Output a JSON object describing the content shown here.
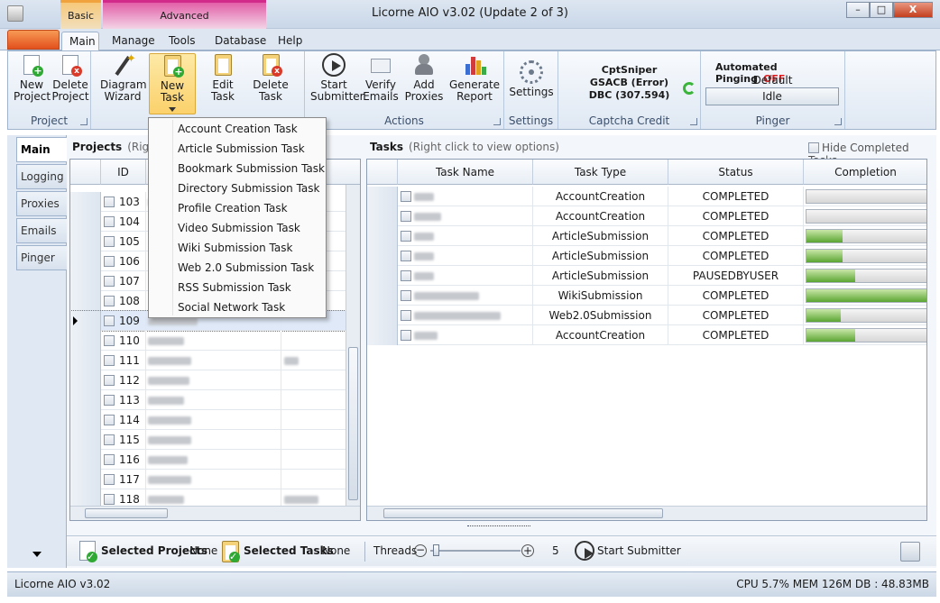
{
  "window": {
    "title": "Licorne AIO v3.02 (Update 2 of 3)",
    "min": "–",
    "max": "□",
    "close": "X"
  },
  "context_tabs": {
    "basic": "Basic",
    "advanced": "Advanced"
  },
  "ribbon_tabs": [
    "Main",
    "Manage",
    "Tools",
    "Database",
    "Help"
  ],
  "ribbon": {
    "project_group": "Project",
    "new_project": "New\nProject",
    "delete_project": "Delete\nProject",
    "diagram_wizard": "Diagram\nWizard",
    "new_task": "New Task",
    "edit_task": "Edit Task",
    "delete_task": "Delete\nTask",
    "start_submitter": "Start\nSubmitter",
    "verify_emails": "Verify\nEmails",
    "add_proxies": "Add\nProxies",
    "generate_report": "Generate\nReport",
    "actions_group": "Actions",
    "settings": "Settings",
    "settings_group": "Settings",
    "captcha_line1": "CptSniper",
    "captcha_line2": "GSACB (Error)",
    "captcha_line3": "DBC (307.594)",
    "captcha_group": "Captcha Credit",
    "pinging_label": "Automated Pinging",
    "pinging_state": "OFF",
    "pinging_profile": "Default",
    "pinging_status": "Idle",
    "pinger_group": "Pinger"
  },
  "new_task_menu": [
    "Account Creation Task",
    "Article Submission Task",
    "Bookmark Submission Task",
    "Directory Submission Task",
    "Profile Creation Task",
    "Video Submission Task",
    "Wiki Submission Task",
    "Web 2.0 Submission Task",
    "RSS Submission Task",
    "Social Network Task"
  ],
  "side_tabs": [
    "Main",
    "Logging",
    "Proxies",
    "Emails",
    "Pinger"
  ],
  "projects": {
    "title": "Projects",
    "hint": "(Right",
    "id_header": "ID",
    "rows": [
      {
        "id": "103"
      },
      {
        "id": "104"
      },
      {
        "id": "105"
      },
      {
        "id": "106"
      },
      {
        "id": "107"
      },
      {
        "id": "108"
      },
      {
        "id": "109"
      },
      {
        "id": "110"
      },
      {
        "id": "111"
      },
      {
        "id": "112"
      },
      {
        "id": "113"
      },
      {
        "id": "114"
      },
      {
        "id": "115"
      },
      {
        "id": "116"
      },
      {
        "id": "117"
      },
      {
        "id": "118"
      }
    ]
  },
  "tasks": {
    "title": "Tasks",
    "hint": "(Right click to view options)",
    "hide_completed": "Hide Completed Tasks",
    "headers": [
      "Task Name",
      "Task Type",
      "Status",
      "Completion"
    ],
    "rows": [
      {
        "type": "AccountCreation",
        "status": "COMPLETED",
        "progress": 0
      },
      {
        "type": "AccountCreation",
        "status": "COMPLETED",
        "progress": 0
      },
      {
        "type": "ArticleSubmission",
        "status": "COMPLETED",
        "progress": 0.3
      },
      {
        "type": "ArticleSubmission",
        "status": "COMPLETED",
        "progress": 0.3
      },
      {
        "type": "ArticleSubmission",
        "status": "PAUSEDBYUSER",
        "progress": 0.4
      },
      {
        "type": "WikiSubmission",
        "status": "COMPLETED",
        "progress": 1.0
      },
      {
        "type": "Web2.0Submission",
        "status": "COMPLETED",
        "progress": 0.28
      },
      {
        "type": "AccountCreation",
        "status": "COMPLETED",
        "progress": 0.4
      }
    ]
  },
  "bottom": {
    "selected_projects": "Selected Projects",
    "selected_projects_value": "None",
    "selected_tasks": "Selected Tasks",
    "selected_tasks_value": "None",
    "threads_label": "Threads",
    "threads_value": "5",
    "start_submitter": "Start Submitter"
  },
  "status": {
    "left": "Licorne AIO v3.02",
    "right": "CPU 5.7% MEM 126M DB : 48.83MB"
  }
}
